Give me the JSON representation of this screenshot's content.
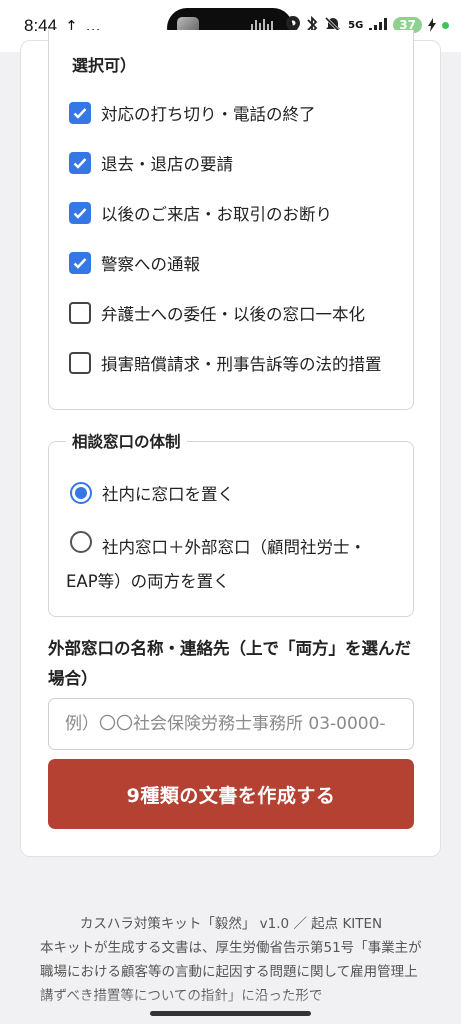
{
  "status_bar": {
    "time": "8:44",
    "indicators": [
      "↑",
      "…"
    ],
    "network": "5G",
    "battery": "37"
  },
  "countermeasures": {
    "legend_tail": "選択可）",
    "options": [
      {
        "label": "対応の打ち切り・電話の終了",
        "checked": true
      },
      {
        "label": "退去・退店の要請",
        "checked": true
      },
      {
        "label": "以後のご来店・お取引のお断り",
        "checked": true
      },
      {
        "label": "警察への通報",
        "checked": true
      },
      {
        "label": "弁護士への委任・以後の窓口一本化",
        "checked": false
      },
      {
        "label": "損害賠償請求・刑事告訴等の法的措置",
        "checked": false
      }
    ]
  },
  "consultation": {
    "legend": "相談窓口の体制",
    "options": [
      {
        "label": "社内に窓口を置く",
        "selected": true
      },
      {
        "label_line1": "社内窓口＋外部窓口（顧問社労士・",
        "label_line2": "EAP等）の両方を置く",
        "selected": false
      }
    ]
  },
  "external_contact": {
    "label": "外部窓口の名称・連絡先（上で「両方」を選んだ場合）",
    "placeholder": "例）〇〇社会保険労務士事務所 03-0000-"
  },
  "submit_label": "9種類の文書を作成する",
  "footer": {
    "title": "カスハラ対策キット「毅然」 v1.0 ／ 起点 KITEN",
    "body": "本キットが生成する文書は、厚生労働省告示第51号「事業主が職場における顧客等の言動に起因する問題に関して雇用管理上講ずべき措置等についての指針」に沿った形で"
  },
  "colors": {
    "accent": "#3578e5",
    "submit": "#b44131"
  }
}
